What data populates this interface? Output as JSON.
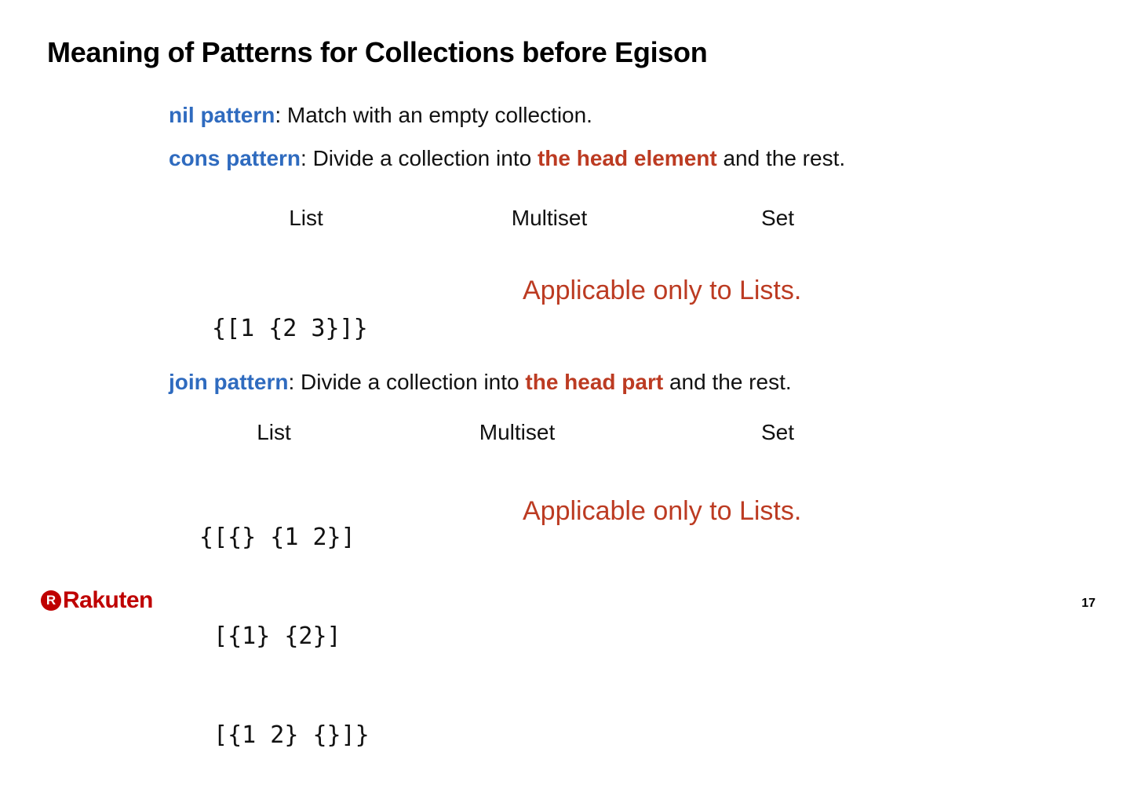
{
  "title": "Meaning of Patterns for Collections before Egison",
  "nil": {
    "keyword": "nil pattern",
    "text": ": Match with an empty collection."
  },
  "cons": {
    "keyword": "cons pattern",
    "text1": ": Divide a collection into ",
    "highlight": "the head element",
    "text2": " and the rest.",
    "columns": [
      "List",
      "Multiset",
      "Set"
    ],
    "code": [
      "{[1 {2 3}]}"
    ],
    "note": "Applicable only to Lists."
  },
  "join": {
    "keyword": "join pattern",
    "text1": ": Divide a collection into ",
    "highlight": "the head part",
    "text2": " and the rest.",
    "columns": [
      "List",
      "Multiset",
      "Set"
    ],
    "code": [
      "{[{} {1 2}]",
      " [{1} {2}]",
      " [{1 2} {}]}"
    ],
    "note": "Applicable only to Lists."
  },
  "footer": {
    "logo_mark": "R",
    "logo_text": "Rakuten",
    "page_number": "17"
  },
  "colors": {
    "keyword": "#2f6bbf",
    "highlight": "#bc3b22",
    "logo": "#bf0000"
  }
}
